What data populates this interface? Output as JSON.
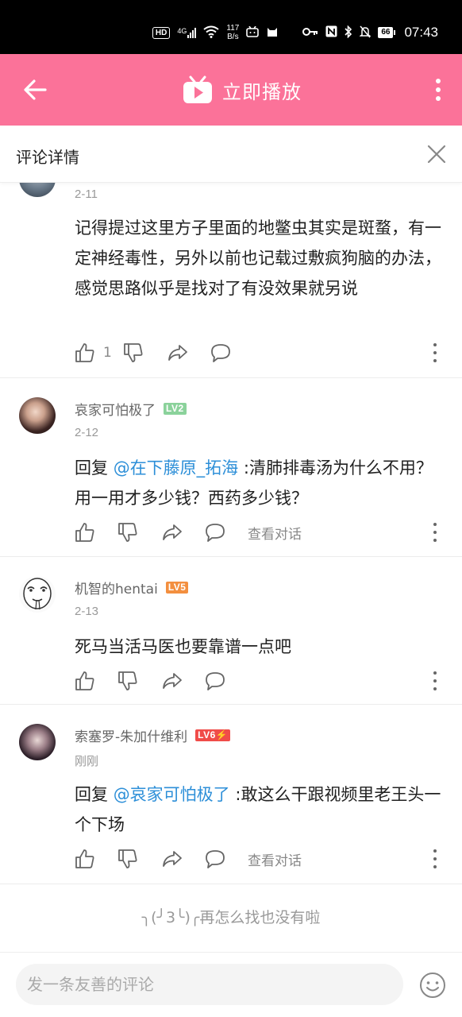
{
  "status_bar": {
    "hd": "HD",
    "network": "4G",
    "speed_value": "117",
    "speed_unit": "B/s",
    "battery": "66",
    "time": "07:43"
  },
  "header": {
    "action_label": "立即播放",
    "accent_color": "#fb7299"
  },
  "panel": {
    "title": "评论详情"
  },
  "comments": [
    {
      "user": "",
      "level": "",
      "date": "2-11",
      "text": "记得提过这里方子里面的地鳖虫其实是斑蝥，有一定神经毒性，另外以前也记载过敷疯狗脑的办法，感觉思路似乎是找对了有没效果就另说",
      "likes": "1",
      "view_dialog": ""
    },
    {
      "user": "哀家可怕极了",
      "level": "LV2",
      "level_color": "#8bd29b",
      "date": "2-12",
      "reply_prefix": "回复 ",
      "mention": "@在下藤原_拓海",
      "text": " :清肺排毒汤为什么不用？用一用才多少钱？西药多少钱？",
      "likes": "",
      "view_dialog": "查看对话"
    },
    {
      "user": "机智的hentai",
      "level": "LV5",
      "level_color": "#f38f3f",
      "date": "2-13",
      "text": "死马当活马医也要靠谱一点吧",
      "likes": "",
      "view_dialog": ""
    },
    {
      "user": "索塞罗-朱加什维利",
      "level": "LV6⚡",
      "level_color": "#f04c49",
      "date": "刚刚",
      "reply_prefix": "回复 ",
      "mention": "@哀家可怕极了",
      "text": " :敢这么干跟视频里老王头一个下场",
      "likes": "",
      "view_dialog": "查看对话"
    }
  ],
  "end_note": "╮(╯3╰)╭再怎么找也没有啦",
  "input": {
    "placeholder": "发一条友善的评论"
  }
}
